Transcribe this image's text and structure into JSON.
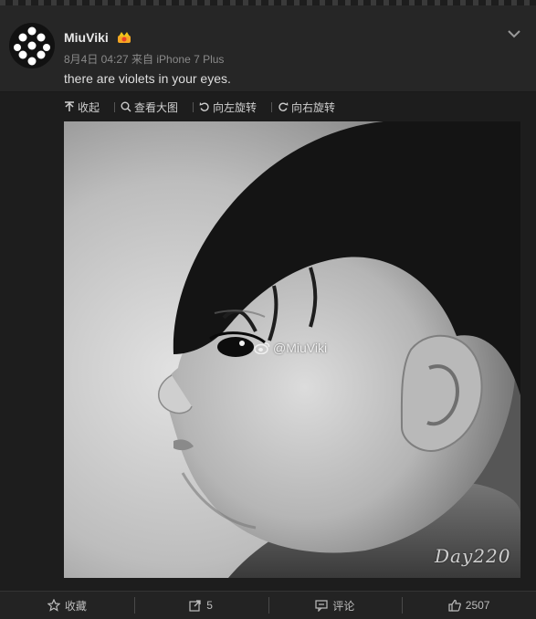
{
  "post": {
    "username": "MiuViki",
    "meta": "8月4日 04:27 来自 iPhone 7 Plus",
    "text": "there are violets in your eyes."
  },
  "toolbar": {
    "collapse": "收起",
    "view_large": "查看大图",
    "rotate_left": "向左旋转",
    "rotate_right": "向右旋转"
  },
  "photo": {
    "watermark": "@MiuViki",
    "day_label": "Day220"
  },
  "actions": {
    "favorite": "收藏",
    "repost_count": "5",
    "comment": "评论",
    "like_count": "2507"
  },
  "icons": [
    "avatar-dots",
    "crown-badge-icon",
    "chevron-down-icon",
    "collapse-up-icon",
    "magnify-icon",
    "rotate-left-icon",
    "rotate-right-icon",
    "weibo-icon",
    "star-icon",
    "share-icon",
    "comment-icon",
    "thumbs-up-icon"
  ]
}
